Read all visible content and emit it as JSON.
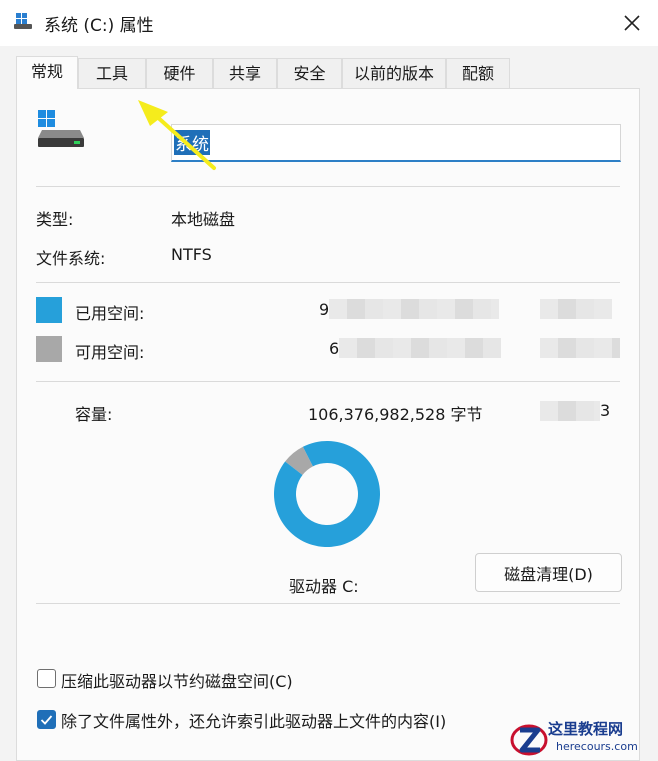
{
  "window": {
    "title": "系统 (C:) 属性"
  },
  "tabs": [
    {
      "label": "常规"
    },
    {
      "label": "工具"
    },
    {
      "label": "硬件"
    },
    {
      "label": "共享"
    },
    {
      "label": "安全"
    },
    {
      "label": "以前的版本"
    },
    {
      "label": "配额"
    }
  ],
  "general": {
    "name_value": "系统",
    "type_label": "类型:",
    "type_value": "本地磁盘",
    "fs_label": "文件系统:",
    "fs_value": "NTFS",
    "used_label": "已用空间:",
    "used_value_visible": "9",
    "free_label": "可用空间:",
    "free_value_visible": "6",
    "capacity_label": "容量:",
    "capacity_value": "106,376,982,528 字节",
    "capacity_size_visible": "3",
    "drive_label": "驱动器 C:",
    "cleanup_button": "磁盘清理(D)",
    "used_fraction": 0.93
  },
  "options": [
    {
      "label": "压缩此驱动器以节约磁盘空间(C)",
      "checked": false
    },
    {
      "label": "除了文件属性外，还允许索引此驱动器上文件的内容(I)",
      "checked": true
    }
  ],
  "colors": {
    "used": "#26a0da",
    "free": "#a8a8a8",
    "accent": "#1f6fb8",
    "annotation_arrow": "#f5ec1c"
  },
  "watermark": {
    "title": "这里教程网",
    "url": "herecours.com"
  }
}
